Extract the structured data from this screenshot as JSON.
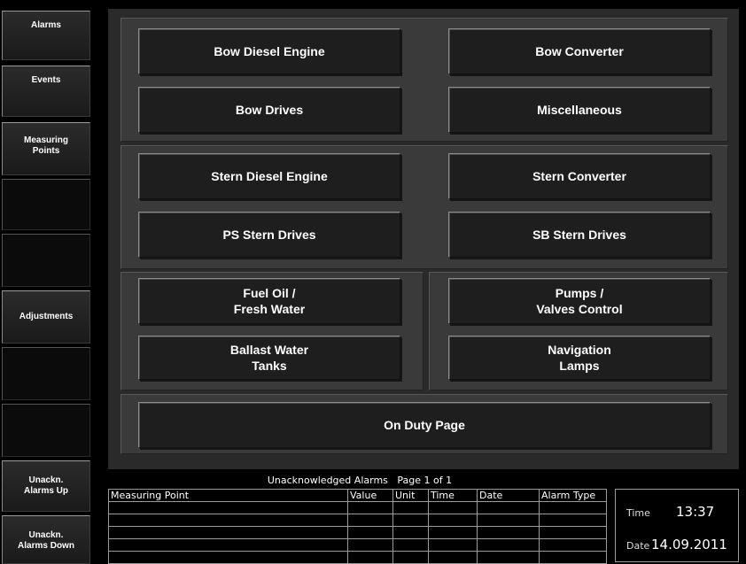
{
  "sidebar": {
    "items": [
      {
        "label": "Alarms"
      },
      {
        "label": "Events"
      },
      {
        "label": "Measuring\nPoints"
      },
      {
        "label": ""
      },
      {
        "label": ""
      },
      {
        "label": "Adjustments"
      },
      {
        "label": ""
      },
      {
        "label": ""
      },
      {
        "label": "Unackn.\nAlarms Up"
      },
      {
        "label": "Unackn.\nAlarms Down"
      }
    ]
  },
  "main": {
    "buttons": {
      "bow_diesel": "Bow Diesel Engine",
      "bow_converter": "Bow Converter",
      "bow_drives": "Bow Drives",
      "misc": "Miscellaneous",
      "stern_diesel": "Stern Diesel Engine",
      "stern_converter": "Stern Converter",
      "ps_stern": "PS Stern Drives",
      "sb_stern": "SB Stern Drives",
      "fuel_oil": "Fuel Oil /\nFresh Water",
      "pumps": "Pumps /\nValves Control",
      "ballast": "Ballast Water\nTanks",
      "navigation": "Navigation\nLamps",
      "on_duty": "On Duty Page"
    }
  },
  "alarm_table": {
    "title": "Unacknowledged Alarms   Page 1 of 1",
    "headers": [
      "Measuring Point",
      "Value",
      "Unit",
      "Time",
      "Date",
      "Alarm Type"
    ]
  },
  "clock": {
    "time_label": "Time",
    "time_value": "13:37",
    "date_label": "Date",
    "date_value": "14.09.2011"
  }
}
